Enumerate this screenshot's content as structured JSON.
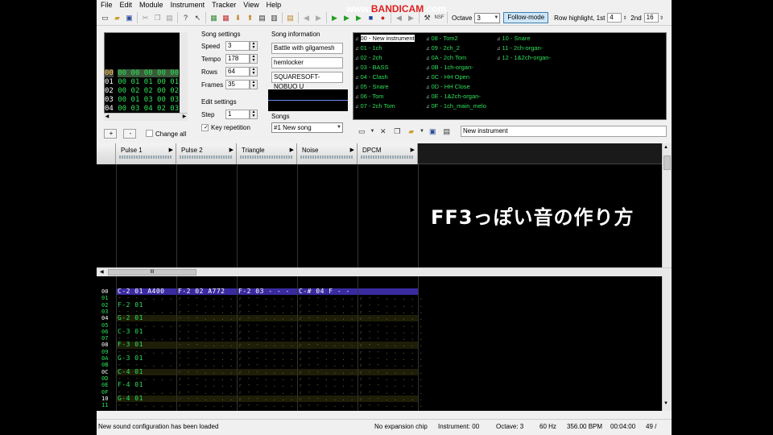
{
  "watermark": {
    "prefix": "www.",
    "brand": "BANDICAM",
    "suffix": ".com"
  },
  "menu": [
    "File",
    "Edit",
    "Module",
    "Instrument",
    "Tracker",
    "View",
    "Help"
  ],
  "toolbar": {
    "nsf": "NSF",
    "octave_label": "Octave",
    "octave": "3",
    "follow": "Follow-mode",
    "row_hl_label": "Row highlight, 1st",
    "hl1": "4",
    "second_label": "2nd",
    "hl2": "16"
  },
  "patterns": [
    {
      "row": "00",
      "vals": "00 00 00 00 00"
    },
    {
      "row": "01",
      "vals": "00 01 01 00 01"
    },
    {
      "row": "02",
      "vals": "00 02 02 00 02"
    },
    {
      "row": "03",
      "vals": "00 01 03 00 03"
    },
    {
      "row": "04",
      "vals": "00 03 04 02 03"
    }
  ],
  "pattern_buttons": {
    "add": "+",
    "remove": "-",
    "change_all": "Change all"
  },
  "song_settings": {
    "title": "Song settings",
    "speed_label": "Speed",
    "speed": "3",
    "tempo_label": "Tempo",
    "tempo": "178",
    "rows_label": "Rows",
    "rows": "64",
    "frames_label": "Frames",
    "frames": "35"
  },
  "edit_settings": {
    "title": "Edit settings",
    "step_label": "Step",
    "step": "1",
    "key_rep": "Key repetition"
  },
  "song_info": {
    "title": "Song information",
    "name": "Battle with gilgamesh",
    "artist": "hemlocker",
    "copyright": "SQUARESOFT-NOBUO U"
  },
  "songs": {
    "title": "Songs",
    "selected": "#1 New song"
  },
  "instruments": [
    "00 - New instrument",
    "01 - 1ch",
    "02 - 2ch",
    "03 - BASS",
    "04 - Clash",
    "05 - Snare",
    "06 - Tom",
    "07 - 2ch Tom",
    "08 - Tom2",
    "09 - 2ch_2",
    "0A - 2ch Tom",
    "0B - 1ch-organ-",
    "0C - HH Open",
    "0D - HH Close",
    "0E - 1&2ch-organ-",
    "0F - 1ch_main_melo",
    "10 - Snare",
    "11 - 2ch-organ-",
    "12 - 1&2ch-organ-"
  ],
  "instrument_name": "New instrument",
  "channels": [
    "Pulse 1",
    "Pulse 2",
    "Triangle",
    "Noise",
    "DPCM"
  ],
  "rows": [
    "00",
    "01",
    "02",
    "03",
    "04",
    "05",
    "06",
    "07",
    "08",
    "09",
    "0A",
    "0B",
    "0C",
    "0D",
    "0E",
    "0F",
    "10",
    "11"
  ],
  "notes_row0": {
    "p1": "C-2 01 A400",
    "p2": "F-2 02 A772",
    "tri": "F-2 03 - - -",
    "noise": "C-# 04 F - -"
  },
  "pulse1_notes": [
    [
      "02",
      "F-2 01"
    ],
    [
      "04",
      "G-2 01"
    ],
    [
      "06",
      "C-3 01"
    ],
    [
      "08",
      "F-3 01"
    ],
    [
      "0A",
      "G-3 01"
    ],
    [
      "0C",
      "C-4 01"
    ],
    [
      "0E",
      "F-4 01"
    ],
    [
      "10",
      "G-4 01"
    ]
  ],
  "overlay_text": "FF3っぽい音の作り方",
  "status": {
    "message": "New sound configuration has been loaded",
    "chip": "No expansion chip",
    "instrument": "Instrument: 00",
    "octave": "Octave: 3",
    "rate": "60 Hz",
    "bpm": "356.00 BPM",
    "time": "00:04:00",
    "pos": "49 /"
  }
}
